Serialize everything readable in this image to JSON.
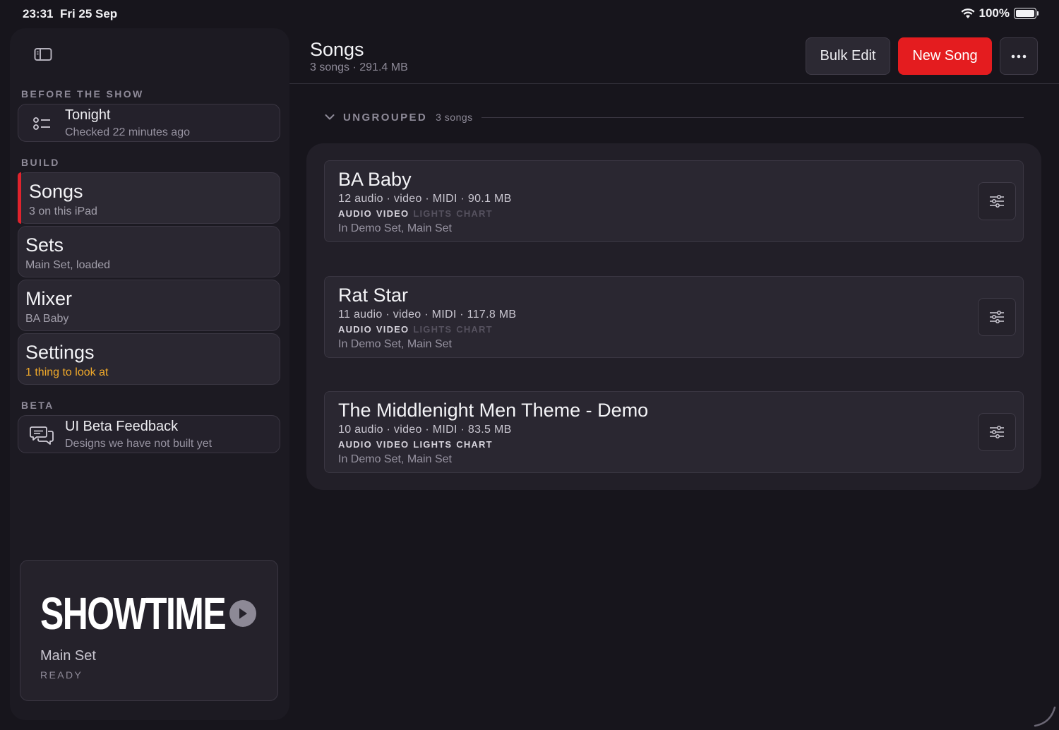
{
  "status_bar": {
    "time": "23:31",
    "date": "Fri 25 Sep",
    "battery": "100%",
    "wifi_icon": "wifi-icon",
    "battery_icon": "battery-icon"
  },
  "sidebar": {
    "toggle_icon": "sidebar-toggle-icon",
    "sections": {
      "before_show": "BEFORE THE SHOW",
      "build": "BUILD",
      "beta": "BETA"
    },
    "tonight": {
      "title": "Tonight",
      "subtitle": "Checked 22 minutes ago",
      "icon": "checklist-icon"
    },
    "nav": [
      {
        "title": "Songs",
        "subtitle": "3 on this iPad",
        "active": true
      },
      {
        "title": "Sets",
        "subtitle": "Main Set, loaded"
      },
      {
        "title": "Mixer",
        "subtitle": "BA Baby"
      },
      {
        "title": "Settings",
        "subtitle": "1 thing to look at",
        "warn": true
      }
    ],
    "feedback": {
      "title": "UI Beta Feedback",
      "subtitle": "Designs we have not built yet",
      "icon": "chat-bubbles-icon"
    },
    "showtime": {
      "title": "SHOWTIME",
      "set": "Main Set",
      "status": "READY",
      "icon": "play-icon"
    }
  },
  "header": {
    "title": "Songs",
    "subtitle": "3 songs · 291.4 MB",
    "bulk_edit": "Bulk Edit",
    "new_song": "New Song",
    "more": "···"
  },
  "group": {
    "label": "UNGROUPED",
    "count": "3 songs",
    "icon": "chevron-down-icon"
  },
  "songs": [
    {
      "title": "BA Baby",
      "meta": "12 audio · video · MIDI · 90.1 MB",
      "tags": {
        "audio": "AUDIO",
        "video": "VIDEO",
        "lights": "LIGHTS",
        "chart": "CHART"
      },
      "tags_active": {
        "audio": true,
        "video": true,
        "lights": false,
        "chart": false
      },
      "sets": "In Demo Set, Main Set"
    },
    {
      "title": "Rat Star",
      "meta": "11 audio · video · MIDI · 117.8 MB",
      "tags": {
        "audio": "AUDIO",
        "video": "VIDEO",
        "lights": "LIGHTS",
        "chart": "CHART"
      },
      "tags_active": {
        "audio": true,
        "video": true,
        "lights": false,
        "chart": false
      },
      "sets": "In Demo Set, Main Set"
    },
    {
      "title": "The Middlenight Men Theme - Demo",
      "meta": "10 audio · video · MIDI · 83.5 MB",
      "tags": {
        "audio": "AUDIO",
        "video": "VIDEO",
        "lights": "LIGHTS",
        "chart": "CHART"
      },
      "tags_active": {
        "audio": true,
        "video": true,
        "lights": true,
        "chart": true
      },
      "sets": "In Demo Set, Main Set"
    }
  ],
  "colors": {
    "accent": "#e41c1f",
    "warn": "#f0a92a",
    "background": "#17151c"
  }
}
